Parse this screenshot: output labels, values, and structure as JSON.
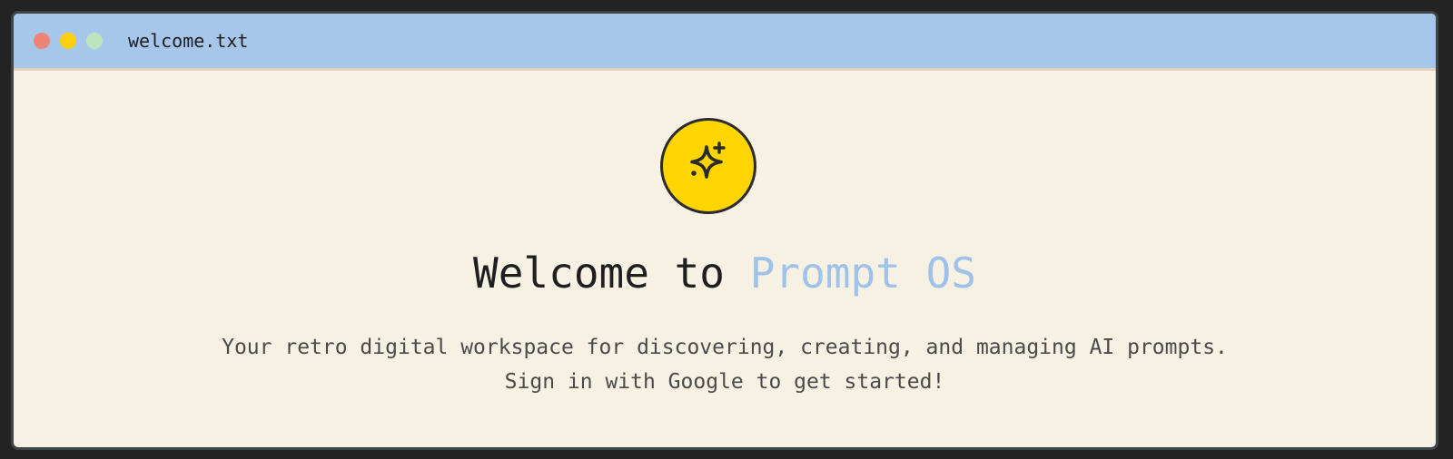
{
  "window": {
    "title": "welcome.txt",
    "controls": [
      {
        "name": "close",
        "color": "#ee8476"
      },
      {
        "name": "minimize",
        "color": "#fdd10a"
      },
      {
        "name": "maximize",
        "color": "#bde5bb"
      }
    ]
  },
  "hero": {
    "icon": "sparkles-icon",
    "headline_prefix": "Welcome to",
    "headline_brand": "Prompt OS",
    "subtitle": "Your retro digital workspace for discovering, creating, and managing AI prompts. Sign in with Google to get started!"
  },
  "colors": {
    "titlebar": "#a6c6ea",
    "background": "#f7f1e4",
    "accent": "#ffd500",
    "brand": "#9fc2ea"
  }
}
